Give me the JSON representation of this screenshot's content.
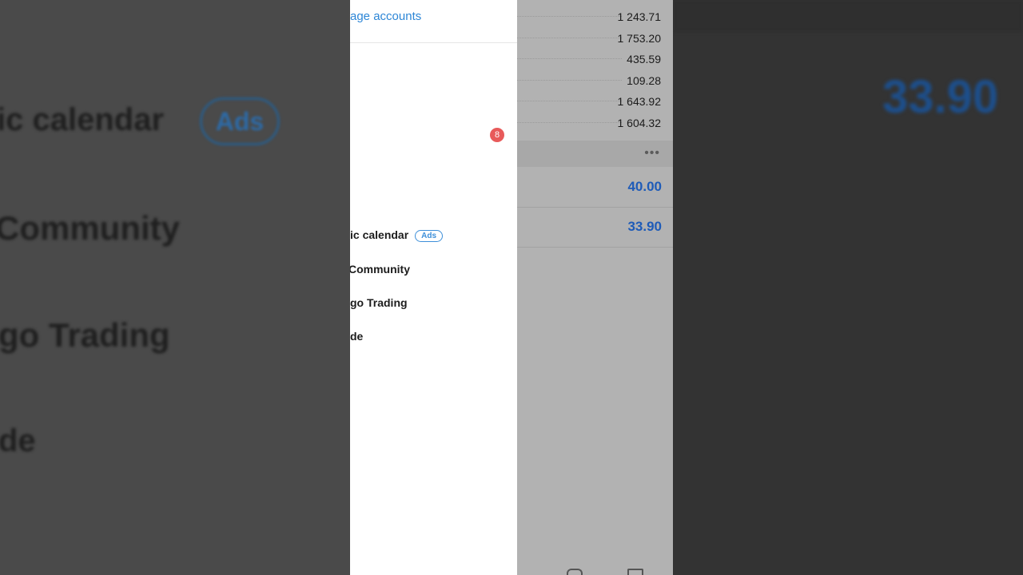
{
  "background_left": {
    "items": [
      "ic calendar",
      "Community",
      "go Trading",
      "de"
    ],
    "ads_label": "Ads"
  },
  "background_right": {
    "price": "33.90"
  },
  "drawer": {
    "manage_accounts": "age accounts",
    "notification_count": "8",
    "menu": [
      {
        "label": "ic calendar",
        "tag": "Ads"
      },
      {
        "label": "Community"
      },
      {
        "label": "go Trading"
      },
      {
        "label": "de"
      }
    ]
  },
  "accounts": {
    "balances": [
      "1 243.71",
      "1 753.20",
      "435.59",
      "109.28",
      "1 643.92",
      "1 604.32"
    ],
    "more_icon": "more-horizontal-icon",
    "prices": [
      "40.00",
      "33.90"
    ]
  },
  "colors": {
    "accent": "#2d86d6",
    "price_blue": "#1e5bb8",
    "badge_red": "#e85a5a",
    "dim_overlay": "#b2b2b2"
  }
}
